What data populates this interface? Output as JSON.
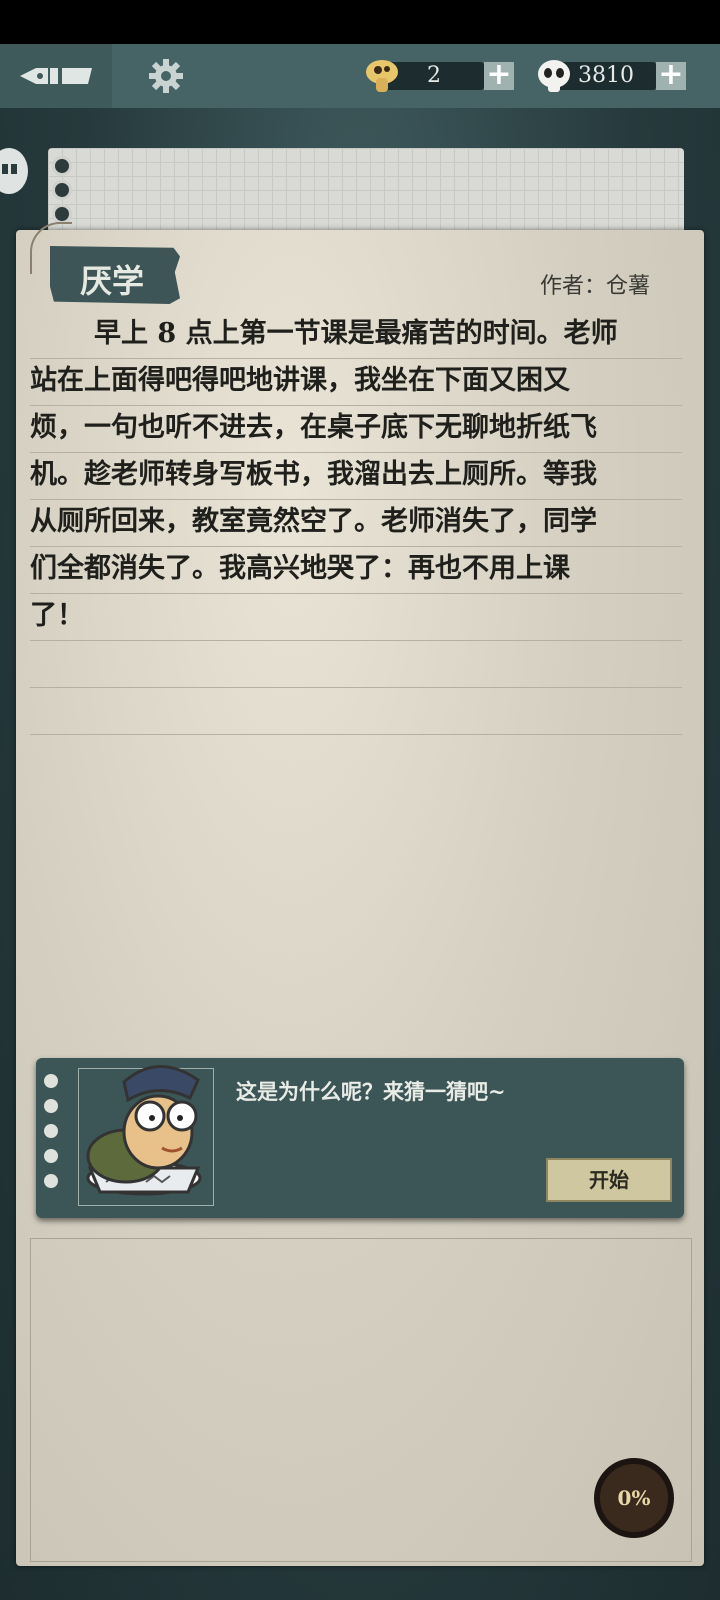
{
  "topbar": {
    "resources": [
      {
        "icon": "mushroom-icon",
        "value": "2"
      },
      {
        "icon": "panda-coin-icon",
        "value": "3810"
      }
    ]
  },
  "story": {
    "title": "厌学",
    "author": "作者：仓薯",
    "lines": [
      "早上 8 点上第一节课是最痛苦的时间。老师",
      "站在上面得吧得吧地讲课，我坐在下面又困又",
      "烦，一句也听不进去，在桌子底下无聊地折纸飞",
      "机。趁老师转身写板书，我溜出去上厕所。等我",
      "从厕所回来，教室竟然空了。老师消失了，同学",
      "们全都消失了。我高兴地哭了：再也不用上课",
      "了！"
    ]
  },
  "dialog": {
    "question": "这是为什么呢？来猜一猜吧~",
    "start_label": "开始"
  },
  "progress": {
    "label": "0%",
    "value": 0
  }
}
